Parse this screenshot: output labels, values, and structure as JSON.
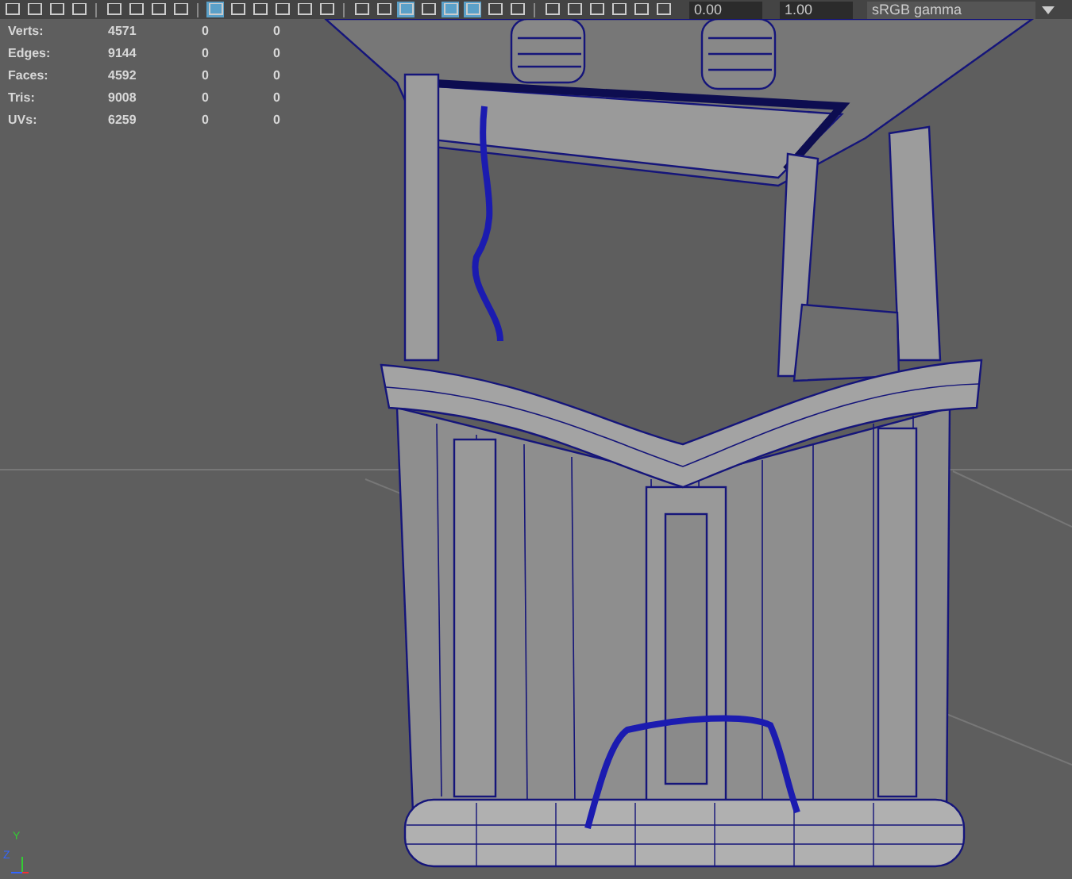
{
  "toolbar": {
    "buttons": [
      {
        "selected": false
      },
      {
        "selected": false
      },
      {
        "selected": false
      },
      {
        "selected": false
      },
      {
        "selected": false
      },
      {
        "selected": false
      },
      {
        "selected": false
      },
      {
        "selected": false
      },
      {
        "selected": true
      },
      {
        "selected": false
      },
      {
        "selected": false
      },
      {
        "selected": false
      },
      {
        "selected": false
      },
      {
        "selected": false
      },
      {
        "selected": false
      },
      {
        "selected": false
      },
      {
        "selected": true
      },
      {
        "selected": false
      },
      {
        "selected": true
      },
      {
        "selected": true
      },
      {
        "selected": false
      },
      {
        "selected": false
      },
      {
        "selected": false
      },
      {
        "selected": false
      },
      {
        "selected": false
      },
      {
        "selected": false
      },
      {
        "selected": false
      },
      {
        "selected": false
      }
    ],
    "exposure": "0.00",
    "gamma": "1.00",
    "color_space": "sRGB gamma"
  },
  "stats": [
    {
      "label": "Verts:",
      "values": [
        "4571",
        "0",
        "0"
      ]
    },
    {
      "label": "Edges:",
      "values": [
        "9144",
        "0",
        "0"
      ]
    },
    {
      "label": "Faces:",
      "values": [
        "4592",
        "0",
        "0"
      ]
    },
    {
      "label": "Tris:",
      "values": [
        "9008",
        "0",
        "0"
      ]
    },
    {
      "label": "UVs:",
      "values": [
        "6259",
        "0",
        "0"
      ]
    }
  ],
  "axis_labels": [
    "Y",
    "Z"
  ]
}
